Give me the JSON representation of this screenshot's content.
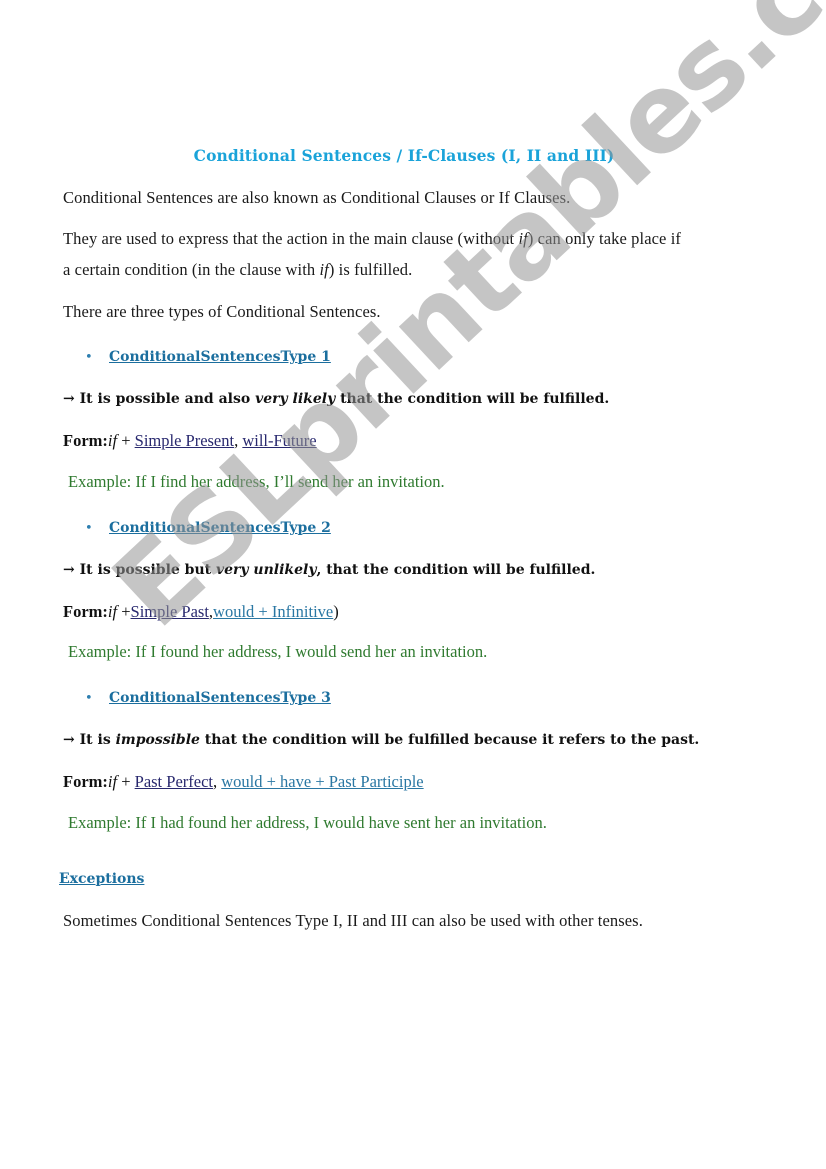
{
  "title": "Conditional Sentences / If-Clauses (I, II and III)",
  "intro": [
    "Conditional Sentences are also known as Conditional Clauses or If Clauses.",
    "They are used to express that the action in the main clause (without ",
    "if",
    ") can only take place if",
    "a certain condition (in the clause with ",
    "if",
    ") is fulfilled.",
    "There are three types of Conditional Sentences."
  ],
  "bullet_glyph": "•",
  "types": [
    {
      "heading": "ConditionalSentencesType 1",
      "arrow": "→",
      "desc_before": "It is possible and also ",
      "desc_em": "very likely",
      "desc_after": " that the condition will be fulfilled.",
      "form_label": "Form:",
      "form_if": "if",
      "form_plus": " + ",
      "form_link1": "Simple Present",
      "form_sep": ", ",
      "form_link2": "will-Future",
      "form_tail": "",
      "example": "Example: If I find her address, I’ll send her an invitation."
    },
    {
      "heading": "ConditionalSentencesType 2",
      "arrow": "→",
      "desc_before": "It is possible but ",
      "desc_em": "very unlikely",
      "desc_after": ", that the condition will be fulfilled.",
      "form_label": "Form:",
      "form_if": "if",
      "form_plus": " +",
      "form_link1": "Simple Past",
      "form_sep": ",",
      "form_link2": "would + Infinitive",
      "form_tail": ")",
      "example": "Example: If I found her address, I would send her an invitation."
    },
    {
      "heading": "ConditionalSentencesType 3",
      "arrow": "→",
      "desc_before": "It is ",
      "desc_em": "impossible",
      "desc_after": " that the condition will be fulfilled because it refers to the past.",
      "form_label": "Form:",
      "form_if": "if",
      "form_plus": " + ",
      "form_link1": "Past Perfect",
      "form_sep": ",  ",
      "form_link2": "would + have + Past Participle",
      "form_tail": "",
      "example": "Example: If I had found her address, I would have sent her an invitation."
    }
  ],
  "exceptions": {
    "heading": "Exceptions",
    "text": "Sometimes Conditional Sentences Type I, II and III can also be used with other tenses."
  },
  "watermark": "ESLprintables.com",
  "colors": {
    "title": "#1aa3d9",
    "type_heading": "#1b6e9e",
    "example": "#2f7a2f",
    "link_navy": "#28286e",
    "link_teal": "#2a77a3"
  }
}
